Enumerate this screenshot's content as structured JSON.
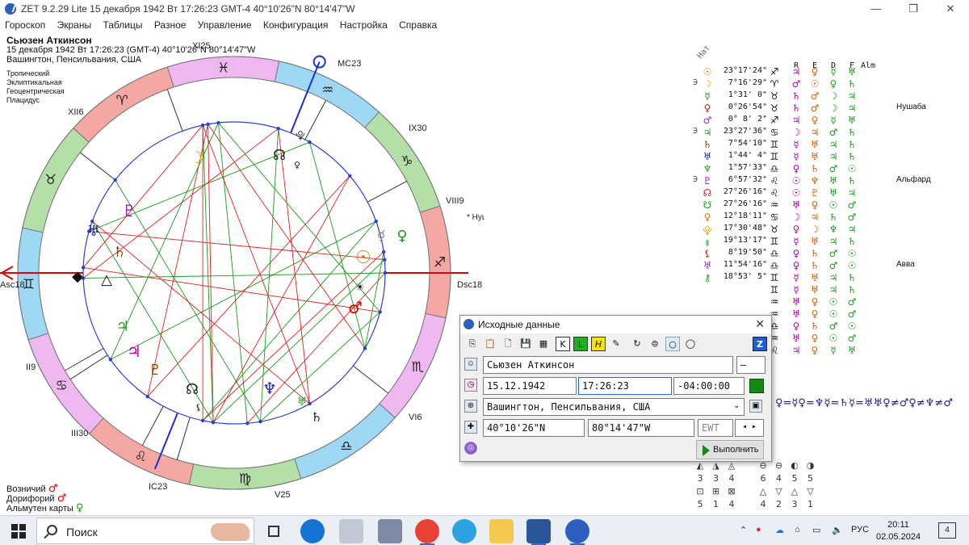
{
  "window": {
    "title": "ZET 9.2.29 Lite   15 декабря 1942  Вт  17:26:23 GMT-4 40°10'26\"N  80°14'47\"W",
    "minimize": "—",
    "maximize": "❐",
    "close": "✕"
  },
  "menu": [
    "Гороскоп",
    "Экраны",
    "Таблицы",
    "Разное",
    "Управление",
    "Конфигурация",
    "Настройка",
    "Справка"
  ],
  "chart_info": {
    "name": "Сьюзен Аткинсон",
    "datetime": "15 декабря 1942  Вт  17:26:23 (GMT-4) 40°10'26\"N  80°14'47\"W",
    "place": "Вашингтон, Пенсильвания, США",
    "zodiac": "Тропический",
    "coords": "Эклиптикальная",
    "center": "Геоцентрическая",
    "houses": "Плацидус"
  },
  "wheel": {
    "house_labels": [
      "XII6",
      "XI25",
      "MC23",
      "IX30",
      "VIII9",
      "Dsc18",
      "VI6",
      "V25",
      "IC23",
      "III30",
      "II9",
      "Asc18"
    ],
    "sign_glyphs": [
      "♓",
      "♒",
      "♑",
      "♐",
      "♏",
      "♎",
      "♍",
      "♌",
      "♋",
      "♊",
      "♉",
      "♈"
    ],
    "outer_star": "Нушаба",
    "colors": {
      "fire": "#f4a7a3",
      "earth": "#b4e0a8",
      "air": "#9fd8f5",
      "water": "#f0b8f0",
      "aspect_red": "#e02020",
      "aspect_green": "#1a9a1a",
      "axis_red": "#e00000",
      "axis_blue": "#1c2fd0"
    }
  },
  "bottom_info": {
    "ruler_label": "Возничий",
    "ruler_glyph": "♂",
    "dorifory_label": "Дорифорий",
    "dorifory_glyph": "♂",
    "almuten_label": "Альмутен карты",
    "almuten_glyph": "♀"
  },
  "planet_table": {
    "header_nat": "Нат",
    "header_r": "R",
    "header_e": "E",
    "header_d": "D",
    "header_f": "F",
    "header_alm": "Alm",
    "rows": [
      {
        "retro": "",
        "glyph": "☉",
        "deg": "23°17'24\"",
        "sign": "♐",
        "r": "♃",
        "e": "♀",
        "d": "☿",
        "f": "♅",
        "star": ""
      },
      {
        "retro": "∋",
        "glyph": "☽",
        "deg": "7°16'29\"",
        "sign": "♈",
        "r": "♂",
        "e": "☉",
        "d": "♀",
        "f": "♄",
        "star": ""
      },
      {
        "retro": "",
        "glyph": "☿",
        "deg": "1°31' 0\"",
        "sign": "♉",
        "r": "♄",
        "e": "♂",
        "d": "☽",
        "f": "♃",
        "star": ""
      },
      {
        "retro": "",
        "glyph": "♀",
        "deg": "0°26'54\"",
        "sign": "♉",
        "r": "♄",
        "e": "♂",
        "d": "☽",
        "f": "♃",
        "star": "Нушаба"
      },
      {
        "retro": "",
        "glyph": "♂",
        "deg": "0° 8' 2\"",
        "sign": "♐",
        "r": "♃",
        "e": "♀",
        "d": "☿",
        "f": "♅",
        "star": ""
      },
      {
        "retro": "∋",
        "glyph": "♃",
        "deg": "23°27'36\"",
        "sign": "♋",
        "r": "☽",
        "e": "♃",
        "d": "♂",
        "f": "♄",
        "star": ""
      },
      {
        "retro": "",
        "glyph": "♄",
        "deg": "7°54'10\"",
        "sign": "♊",
        "r": "☿",
        "e": "♅",
        "d": "♃",
        "f": "♄",
        "star": ""
      },
      {
        "retro": "",
        "glyph": "♅",
        "deg": "1°44' 4\"",
        "sign": "♊",
        "r": "☿",
        "e": "♅",
        "d": "♃",
        "f": "♄",
        "star": ""
      },
      {
        "retro": "",
        "glyph": "♆",
        "deg": "1°57'33\"",
        "sign": "♎",
        "r": "♀",
        "e": "♄",
        "d": "♂",
        "f": "☉",
        "star": ""
      },
      {
        "retro": "∋",
        "glyph": "♇",
        "deg": "6°57'32\"",
        "sign": "♌",
        "r": "☉",
        "e": "♆",
        "d": "♅",
        "f": "♄",
        "star": "Альфард"
      },
      {
        "retro": "",
        "glyph": "☊",
        "deg": "27°26'16\"",
        "sign": "♌",
        "r": "☉",
        "e": "♇",
        "d": "♅",
        "f": "♃",
        "star": ""
      },
      {
        "retro": "",
        "glyph": "☋",
        "deg": "27°26'16\"",
        "sign": "♒",
        "r": "♅",
        "e": "♀",
        "d": "☉",
        "f": "♂",
        "star": ""
      },
      {
        "retro": "",
        "glyph": "♀",
        "deg": "12°18'11\"",
        "sign": "♋",
        "r": "☽",
        "e": "♃",
        "d": "♄",
        "f": "♂",
        "star": ""
      },
      {
        "retro": "",
        "glyph": "⯓",
        "deg": "17°30'48\"",
        "sign": "♉",
        "r": "♀",
        "e": "☽",
        "d": "♆",
        "f": "♃",
        "star": ""
      },
      {
        "retro": "",
        "glyph": "⯒",
        "deg": "19°13'17\"",
        "sign": "♊",
        "r": "☿",
        "e": "♅",
        "d": "♃",
        "f": "♄",
        "star": ""
      },
      {
        "retro": "",
        "glyph": "⚸",
        "deg": "8°19'50\"",
        "sign": "♎",
        "r": "♀",
        "e": "♄",
        "d": "♂",
        "f": "☉",
        "star": ""
      },
      {
        "retro": "",
        "glyph": "♅",
        "deg": "11°54'16\"",
        "sign": "♎",
        "r": "♀",
        "e": "♄",
        "d": "♂",
        "f": "☉",
        "star": "Авва"
      },
      {
        "retro": "",
        "glyph": "⚷",
        "deg": "18°53' 5\"",
        "sign": "♊",
        "r": "☿",
        "e": "♅",
        "d": "♃",
        "f": "♄",
        "star": ""
      },
      {
        "retro": "",
        "glyph": "",
        "deg": "",
        "sign": "♊",
        "r": "☿",
        "e": "♅",
        "d": "♃",
        "f": "♄",
        "star": ""
      },
      {
        "retro": "",
        "glyph": "",
        "deg": "",
        "sign": "♒",
        "r": "♅",
        "e": "♀",
        "d": "☉",
        "f": "♂",
        "star": ""
      },
      {
        "retro": "",
        "glyph": "",
        "deg": "",
        "sign": "♒",
        "r": "♅",
        "e": "♀",
        "d": "☉",
        "f": "♂",
        "star": ""
      },
      {
        "retro": "",
        "glyph": "",
        "deg": "",
        "sign": "♎",
        "r": "♀",
        "e": "♄",
        "d": "♂",
        "f": "☉",
        "star": ""
      },
      {
        "retro": "",
        "glyph": "",
        "deg": "",
        "sign": "♒",
        "r": "♅",
        "e": "♀",
        "d": "☉",
        "f": "♂",
        "star": ""
      },
      {
        "retro": "",
        "glyph": "",
        "deg": "",
        "sign": "♌",
        "r": "♃",
        "e": "♀",
        "d": "☿",
        "f": "♅",
        "star": ""
      }
    ],
    "aspect_formula": "♀=☿♀=♆☿=♄☿=♅♅♀≠♂♀≠♆≠♂"
  },
  "dialog": {
    "title": "Исходные данные",
    "name": "Сьюзен Аткинсон",
    "gender": "–",
    "date": "15.12.1942",
    "time": "17:26:23",
    "tz": "-04:00:00",
    "place": "Вашингтон, Пенсильвания, США",
    "lat": "40°10'26\"N",
    "lon": "80°14'47\"W",
    "ewt": "EWT",
    "execute": "Выполнить"
  },
  "mini_grid": {
    "row1_glyphs": [
      "◭",
      "◮",
      "◬",
      "",
      "⊖",
      "⊖",
      "◐",
      "◑"
    ],
    "row1_nums": [
      "3",
      "3",
      "4",
      "",
      "6",
      "4",
      "5",
      "5"
    ],
    "row2_glyphs": [
      "⊡",
      "⊞",
      "⊠",
      "",
      "△",
      "▽",
      "△",
      "▽"
    ],
    "row2_nums": [
      "5",
      "1",
      "4",
      "",
      "4",
      "2",
      "3",
      "1"
    ]
  },
  "taskbar": {
    "search_placeholder": "Поиск",
    "language": "РУС",
    "time": "20:11",
    "date": "02.05.2024",
    "notifications": "4"
  }
}
